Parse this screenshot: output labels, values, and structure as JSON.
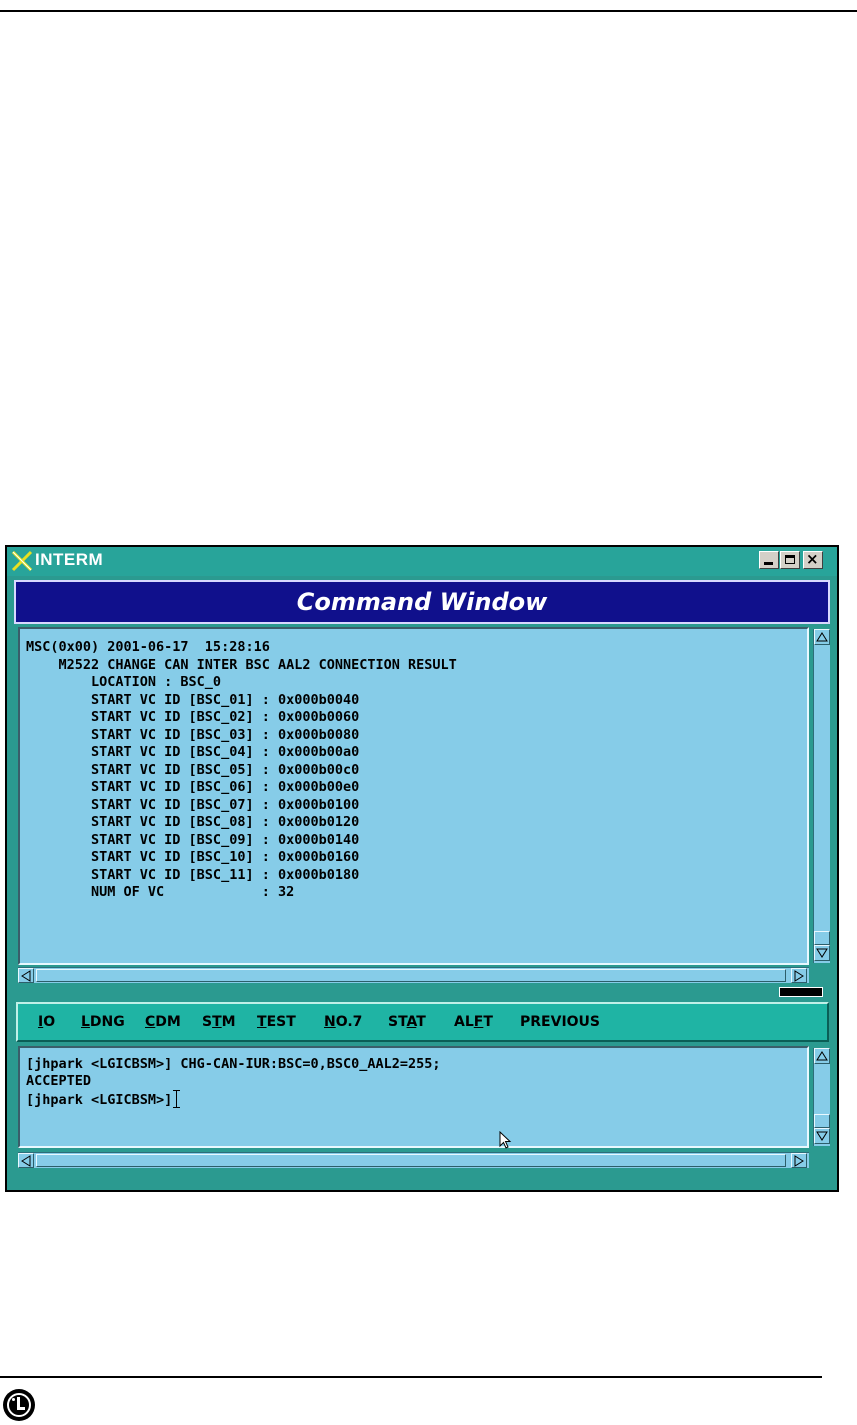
{
  "window": {
    "title": "INTERM",
    "header": "Command Window"
  },
  "output": {
    "lines": [
      "MSC(0x00) 2001-06-17  15:28:16",
      "    M2522 CHANGE CAN INTER BSC AAL2 CONNECTION RESULT",
      "        LOCATION : BSC_0",
      "        START VC ID [BSC_01] : 0x000b0040",
      "        START VC ID [BSC_02] : 0x000b0060",
      "        START VC ID [BSC_03] : 0x000b0080",
      "        START VC ID [BSC_04] : 0x000b00a0",
      "        START VC ID [BSC_05] : 0x000b00c0",
      "        START VC ID [BSC_06] : 0x000b00e0",
      "        START VC ID [BSC_07] : 0x000b0100",
      "        START VC ID [BSC_08] : 0x000b0120",
      "        START VC ID [BSC_09] : 0x000b0140",
      "        START VC ID [BSC_10] : 0x000b0160",
      "        START VC ID [BSC_11] : 0x000b0180",
      "        NUM OF VC            : 32"
    ]
  },
  "menu": {
    "items": [
      {
        "pre": "",
        "u": "I",
        "post": "O"
      },
      {
        "pre": "",
        "u": "L",
        "post": "DNG"
      },
      {
        "pre": "",
        "u": "C",
        "post": "DM"
      },
      {
        "pre": "S",
        "u": "T",
        "post": "M"
      },
      {
        "pre": "",
        "u": "T",
        "post": "EST"
      },
      {
        "pre": "",
        "u": "N",
        "post": "O.7"
      },
      {
        "pre": "ST",
        "u": "A",
        "post": "T"
      },
      {
        "pre": "AL",
        "u": "F",
        "post": "T"
      },
      {
        "pre": "PREVIOUS",
        "u": "",
        "post": ""
      }
    ]
  },
  "input": {
    "lines": [
      "[jhpark <LGICBSM>] CHG-CAN-IUR:BSC=0,BSC0_AAL2=255;",
      "ACCEPTED"
    ],
    "prompt": "[jhpark <LGICBSM>]"
  },
  "colors": {
    "title_bar": "#28a49a",
    "header_bg": "#10108c",
    "panel_bg": "#86cce8",
    "menu_bg": "#1fb4a4"
  }
}
